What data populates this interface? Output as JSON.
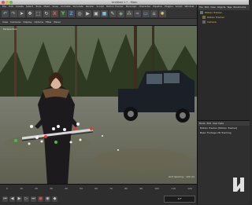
{
  "window": {
    "title": "Untitled 1 * - Main"
  },
  "menu": [
    "File",
    "Edit",
    "Create",
    "Select",
    "Tools",
    "Mesh",
    "Snap",
    "Animate",
    "Simulate",
    "Render",
    "Sculpt",
    "Motion Tracker",
    "MoGraph",
    "Character",
    "Pipeline",
    "Plugins",
    "Script",
    "Window",
    "Help"
  ],
  "toolbar": {
    "icons": [
      "undo-icon",
      "redo-icon",
      "select-icon",
      "move-icon",
      "scale-icon",
      "rotate-icon",
      "x-axis-icon",
      "y-axis-icon",
      "z-axis-icon",
      "world-icon",
      "render-icon",
      "render-view-icon",
      "cube-icon",
      "pen-icon",
      "subdivide-icon",
      "array-icon",
      "deformer-icon",
      "floor-icon",
      "camera-icon",
      "light-icon"
    ]
  },
  "viewport": {
    "menu": [
      "View",
      "Cameras",
      "Display",
      "Options",
      "Filter",
      "Panel"
    ],
    "label": "Perspective",
    "grid_label": "Grid Spacing : 100 cm"
  },
  "timeline": {
    "ticks": [
      "0",
      "10",
      "20",
      "30",
      "40",
      "50",
      "60",
      "70",
      "80",
      "90",
      "100",
      "110",
      "120"
    ],
    "frame_readout": "0 F"
  },
  "object_manager": {
    "menu": [
      "File",
      "Edit",
      "View",
      "Objects",
      "Tags",
      "Bookmarks"
    ],
    "objects": [
      "Motion Tracker",
      "Motion Tracker",
      "Camera"
    ]
  },
  "attribute_manager": {
    "menu": [
      "Mode",
      "Edit",
      "User Data"
    ],
    "rows": [
      "Motion Tracker [Motion Tracker]",
      "Basic   Footage   2D Tracking"
    ]
  }
}
